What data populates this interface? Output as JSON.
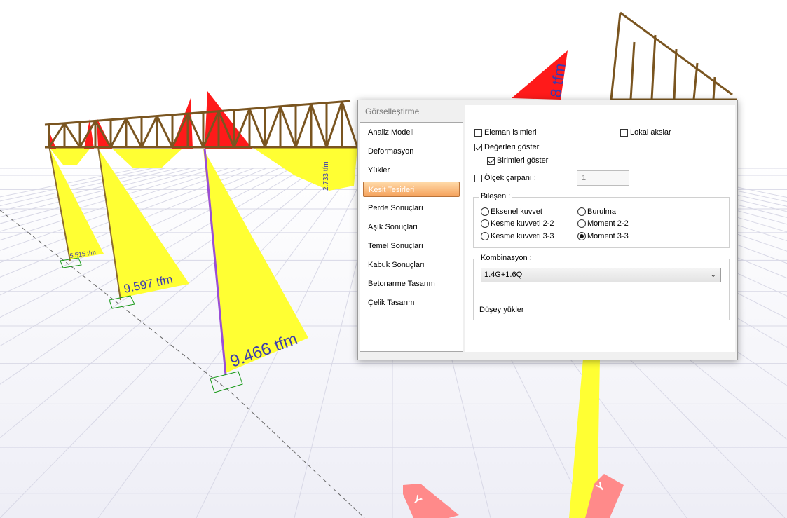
{
  "viewport": {
    "labels": {
      "col1_moment": "5.515 tfm",
      "col2_moment": "9.597 tfm",
      "col3_moment": "9.466 tfm",
      "beam_moment": "2.733 tfm",
      "top_moment": "8 tfm",
      "axis_y1": "Y",
      "axis_y2": "Y"
    },
    "colors": {
      "moment_positive": "#ffff33",
      "moment_negative": "#ff1a1a",
      "truss": "#7a5520",
      "label_text": "#3b3bb0",
      "axis_arrow": "#ff8a8a"
    }
  },
  "dialog": {
    "title": "Görselleştirme",
    "close_icon": "close-icon",
    "nav": [
      {
        "label": "Analiz Modeli",
        "selected": false
      },
      {
        "label": "Deformasyon",
        "selected": false
      },
      {
        "label": "Yükler",
        "selected": false
      },
      {
        "label": "Kesit Tesirleri",
        "selected": true
      },
      {
        "label": "Perde Sonuçları",
        "selected": false
      },
      {
        "label": "Aşık Sonuçları",
        "selected": false
      },
      {
        "label": "Temel Sonuçları",
        "selected": false
      },
      {
        "label": "Kabuk Sonuçları",
        "selected": false
      },
      {
        "label": "Betonarme Tasarım",
        "selected": false
      },
      {
        "label": "Çelik Tasarım",
        "selected": false
      }
    ],
    "options": {
      "eleman_isimleri": {
        "label": "Eleman isimleri",
        "checked": false
      },
      "lokal_akslar": {
        "label": "Lokal akslar",
        "checked": false
      },
      "degerleri_goster": {
        "label": "Değerleri göster",
        "checked": true
      },
      "birimleri_goster": {
        "label": "Birimleri göster",
        "checked": true
      },
      "olcek_carpani": {
        "label": "Ölçek çarpanı :",
        "checked": false,
        "value": "1"
      }
    },
    "bilesen": {
      "label": "Bileşen :",
      "items": [
        {
          "label": "Eksenel kuvvet",
          "selected": false
        },
        {
          "label": "Kesme kuvveti 2-2",
          "selected": false
        },
        {
          "label": "Kesme kuvveti 3-3",
          "selected": false
        },
        {
          "label": "Burulma",
          "selected": false
        },
        {
          "label": "Moment 2-2",
          "selected": false
        },
        {
          "label": "Moment 3-3",
          "selected": true
        }
      ]
    },
    "kombinasyon": {
      "label": "Kombinasyon :",
      "selected": "1.4G+1.6Q",
      "description": "Düşey yükler"
    }
  }
}
